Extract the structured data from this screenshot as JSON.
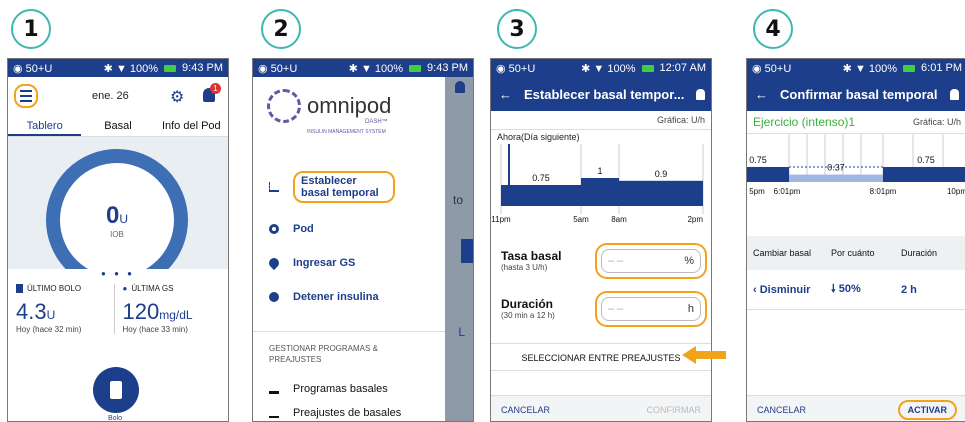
{
  "steps": [
    "1",
    "2",
    "3",
    "4"
  ],
  "status": {
    "p1": {
      "left": "◉ 50+U",
      "right": "✱ ▼ 100%",
      "time": "9:43 PM"
    },
    "p2": {
      "left": "◉ 50+U",
      "right": "✱ ▼ 100%",
      "time": "9:43 PM"
    },
    "p3": {
      "left": "◉ 50+U",
      "right": "✱ ▼ 100%",
      "time": "12:07 AM"
    },
    "p4": {
      "left": "◉ 50+U",
      "right": "✱ ▼ 100%",
      "time": "6:01 PM"
    }
  },
  "screen1": {
    "date": "ene. 26",
    "notification_count": "1",
    "tabs": [
      "Tablero",
      "Basal",
      "Info del Pod"
    ],
    "iob_value": "0",
    "iob_unit": "U",
    "iob_label": "IOB",
    "dots": "● ● ●",
    "last_bolus_title": "ÚLTIMO BOLO",
    "last_bolus_value": "4.3",
    "last_bolus_unit": "U",
    "last_bolus_time": "Hoy (hace 32 min)",
    "last_gs_title": "ÚLTIMA GS",
    "last_gs_value": "120",
    "last_gs_unit": "mg/dL",
    "last_gs_time": "Hoy (hace 33 min)",
    "bolus_button": "Bolo"
  },
  "screen2": {
    "logo": "omnipod",
    "logo_sub": "DASH™",
    "logo_tag": "INSULIN MANAGEMENT SYSTEM",
    "menu": [
      "Establecer basal temporal",
      "Pod",
      "Ingresar GS",
      "Detener insulina"
    ],
    "section_title": "GESTIONAR PROGRAMAS & PREAJUSTES",
    "section_items": [
      "Programas basales",
      "Preajustes de basales"
    ],
    "behind_text": "to",
    "behind_letter": "L"
  },
  "screen3": {
    "title": "Establecer basal tempor...",
    "units_label": "Gráfica: U/h",
    "chart_title": "Ahora(Día siguiente)",
    "field1_label": "Tasa basal",
    "field1_sub": "(hasta 3 U/h)",
    "field1_placeholder": "– –",
    "field1_unit": "%",
    "field2_label": "Duración",
    "field2_sub": "(30 min a 12 h)",
    "field2_placeholder": "– –",
    "field2_unit": "h",
    "preset_button": "SELECCIONAR ENTRE PREAJUSTES",
    "cancel": "CANCELAR",
    "confirm": "CONFIRMAR"
  },
  "screen4": {
    "title": "Confirmar basal temporal",
    "preset_name": "Ejercicio (intenso)1",
    "units_label": "Gráfica: U/h",
    "table_headers": [
      "Cambiar basal",
      "Por cuánto",
      "Duración"
    ],
    "row_change": "Disminuir",
    "row_amount": "50%",
    "row_duration": "2 h",
    "cancel": "CANCELAR",
    "activate": "ACTIVAR"
  },
  "chart_data": [
    {
      "type": "bar",
      "x": [
        "11pm",
        "5am",
        "8am",
        "2pm"
      ],
      "values": [
        0.75,
        1,
        0.9
      ]
    },
    {
      "type": "bar",
      "x": [
        "5pm",
        "6:01pm",
        "8:01pm",
        "10pm"
      ],
      "values": [
        0.75,
        0.37,
        0.75
      ]
    }
  ],
  "colors": {
    "navy": "#1d3e8a",
    "highlight": "#f1a31c",
    "teal": "#3cb8b1",
    "green": "#3cb03c"
  }
}
